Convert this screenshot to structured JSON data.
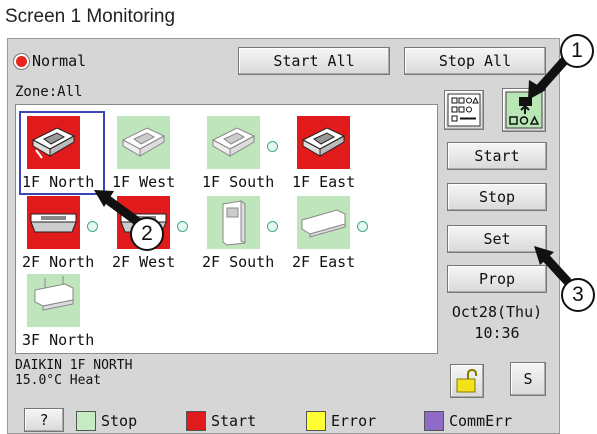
{
  "screen_title": "Screen 1 Monitoring",
  "status": {
    "label": "Normal",
    "color": "#e8261e"
  },
  "toolbar": {
    "start_all": "Start All",
    "stop_all": "Stop All"
  },
  "zone_label": "Zone:All",
  "units": [
    {
      "label": "1F North",
      "state": "start",
      "icon": "cassette-ac-icon",
      "selected": true
    },
    {
      "label": "1F West",
      "state": "stop",
      "icon": "cassette-ac-icon"
    },
    {
      "label": "1F South",
      "state": "stop",
      "icon": "cassette-ac-icon"
    },
    {
      "label": "1F East",
      "state": "start",
      "icon": "cassette-ac-icon"
    },
    {
      "label": "2F North",
      "state": "start",
      "icon": "cassette-ac-icon"
    },
    {
      "label": "2F West",
      "state": "start",
      "icon": "cassette-ac-icon"
    },
    {
      "label": "2F South",
      "state": "stop",
      "icon": "floor-standing-ac-icon"
    },
    {
      "label": "2F East",
      "state": "stop",
      "icon": "wall-mounted-ac-icon"
    },
    {
      "label": "3F North",
      "state": "stop",
      "icon": "ceiling-suspended-ac-icon"
    }
  ],
  "detail": {
    "line1": "DAIKIN 1F NORTH",
    "line2": "15.0°C  Heat"
  },
  "side_buttons": {
    "start": "Start",
    "stop": "Stop",
    "set": "Set",
    "prop": "Prop",
    "s": "S"
  },
  "datetime": {
    "date": "Oct28(Thu)",
    "time": "10:36"
  },
  "help_button": "?",
  "legend": [
    {
      "label": "Stop",
      "color": "#c4ebc2"
    },
    {
      "label": "Start",
      "color": "#e11b1b"
    },
    {
      "label": "Error",
      "color": "#ffff33"
    },
    {
      "label": "CommErr",
      "color": "#8e6bc6"
    }
  ],
  "callouts": [
    "1",
    "2",
    "3"
  ]
}
